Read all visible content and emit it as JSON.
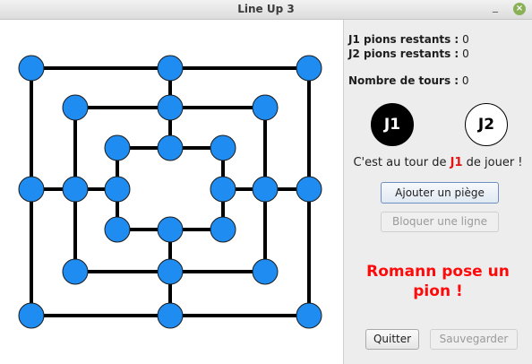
{
  "window": {
    "title": "Line Up 3",
    "minimize_glyph": "_",
    "close_glyph": "×"
  },
  "board": {
    "line_color": "#000000",
    "point_color": "#1e8cf0",
    "points": [
      [
        0,
        0
      ],
      [
        3,
        0
      ],
      [
        6,
        0
      ],
      [
        1,
        1
      ],
      [
        3,
        1
      ],
      [
        5,
        1
      ],
      [
        2,
        2
      ],
      [
        3,
        2
      ],
      [
        4,
        2
      ],
      [
        0,
        3
      ],
      [
        1,
        3
      ],
      [
        2,
        3
      ],
      [
        4,
        3
      ],
      [
        5,
        3
      ],
      [
        6,
        3
      ],
      [
        2,
        4
      ],
      [
        3,
        4
      ],
      [
        4,
        4
      ],
      [
        1,
        5
      ],
      [
        3,
        5
      ],
      [
        5,
        5
      ],
      [
        0,
        6
      ],
      [
        3,
        6
      ],
      [
        6,
        6
      ]
    ]
  },
  "stats": {
    "j1_label": "J1 pions restants :",
    "j1_value": "0",
    "j2_label": "J2 pions restants :",
    "j2_value": "0",
    "turns_label": "Nombre de tours :",
    "turns_value": "0"
  },
  "players": {
    "p1": "J1",
    "p2": "J2"
  },
  "turn": {
    "prefix": "C'est au tour de ",
    "player": "J1",
    "suffix": " de jouer !"
  },
  "actions": {
    "add_trap": "Ajouter un piège",
    "block_line": "Bloquer une ligne"
  },
  "message": {
    "line1": "Romann pose un",
    "line2": "pion !"
  },
  "footer": {
    "quit": "Quitter",
    "save": "Sauvegarder"
  }
}
